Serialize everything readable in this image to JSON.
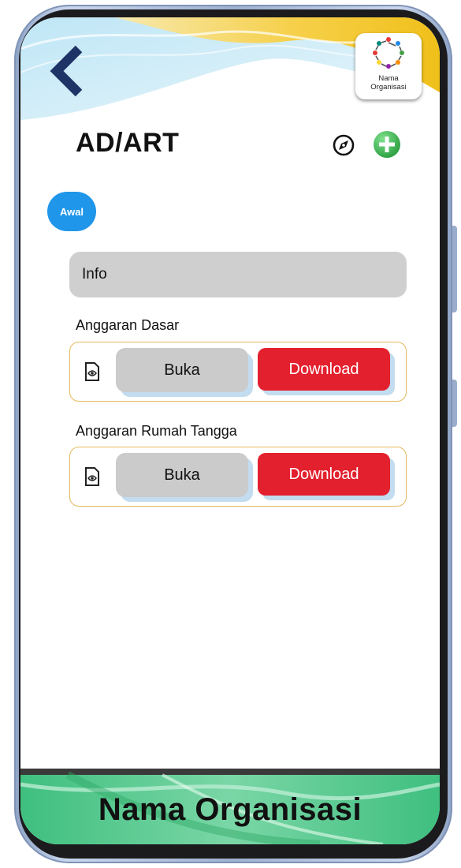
{
  "header": {
    "logo_text_line1": "Nama",
    "logo_text_line2": "Organisasi"
  },
  "page": {
    "title": "AD/ART",
    "chip_label": "Awal",
    "info_label": "Info"
  },
  "documents": [
    {
      "label": "Anggaran Dasar",
      "open_label": "Buka",
      "download_label": "Download"
    },
    {
      "label": "Anggaran Rumah Tangga",
      "open_label": "Buka",
      "download_label": "Download"
    }
  ],
  "footer": {
    "title": "Nama Organisasi"
  },
  "colors": {
    "chip": "#1f96ea",
    "download": "#e3202e",
    "add": "#2fb84a",
    "card_border": "#e2b95c",
    "footer_green": "#4cc58a"
  },
  "icons": {
    "back": "chevron-left-icon",
    "edit": "compass-edit-icon",
    "add": "plus-circle-icon",
    "document": "document-eye-icon"
  }
}
